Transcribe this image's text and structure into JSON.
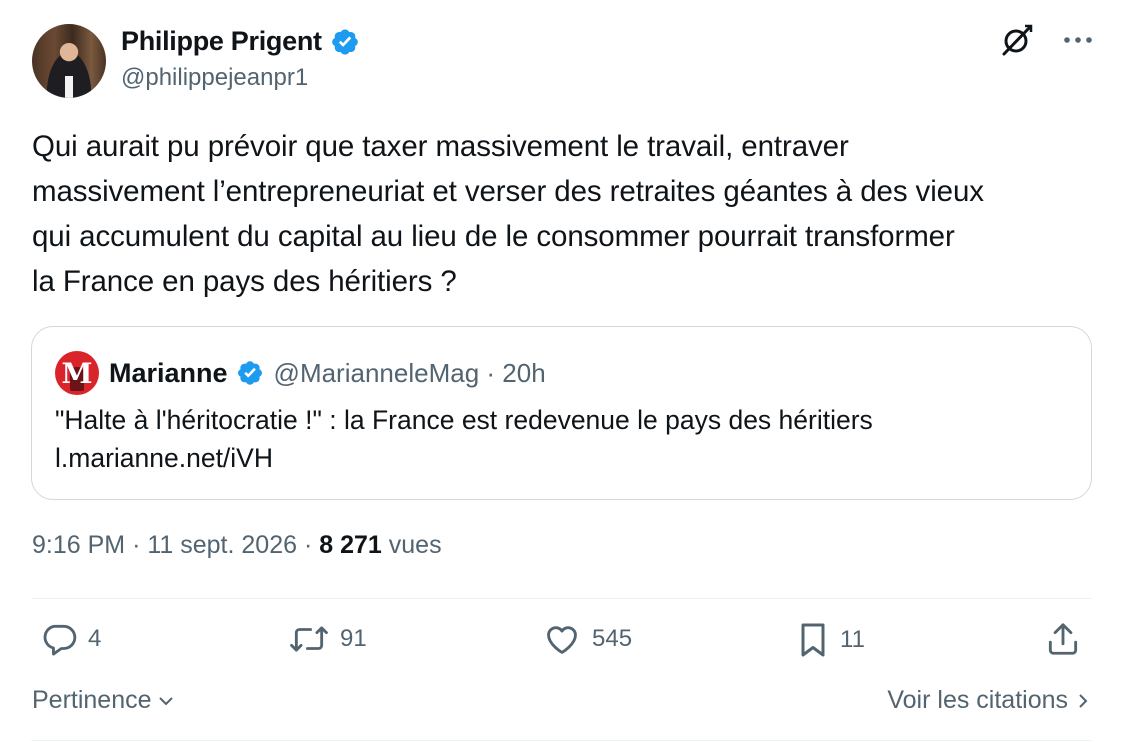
{
  "author": {
    "name": "Philippe Prigent",
    "handle": "@philippejeanpr1"
  },
  "tweet": {
    "text_lines": [
      "Qui aurait pu prévoir que taxer massivement le travail, entraver",
      "massivement l’entrepreneuriat et verser des retraites géantes à des vieux",
      "qui accumulent du capital au lieu de le consommer pourrait transformer",
      "la France en pays des héritiers ?"
    ],
    "time": "9:16 PM",
    "date": "11 sept. 2026",
    "views_count": "8 271",
    "views_label": "vues"
  },
  "quoted": {
    "logo_letter": "M",
    "name": "Marianne",
    "handle": "@MarianneleMag",
    "age": "20h",
    "text": "\"Halte à l'héritocratie !\" : la France est redevenue le pays des héritiers",
    "link": "l.marianne.net/iVH"
  },
  "actions": {
    "replies": "4",
    "reposts": "91",
    "likes": "545",
    "bookmarks": "11"
  },
  "footer": {
    "sort_label": "Pertinence",
    "quotes_label": "Voir les citations"
  },
  "colors": {
    "verified": "#1d9bf0",
    "text": "#0f1419",
    "secondary": "#536471",
    "border": "#cfd9de",
    "brand_red": "#d9242b"
  },
  "icons": [
    "verified-badge-icon",
    "grok-icon",
    "more-icon",
    "reply-icon",
    "repost-icon",
    "like-icon",
    "bookmark-icon",
    "share-icon",
    "chevron-down-icon",
    "chevron-right-icon"
  ]
}
